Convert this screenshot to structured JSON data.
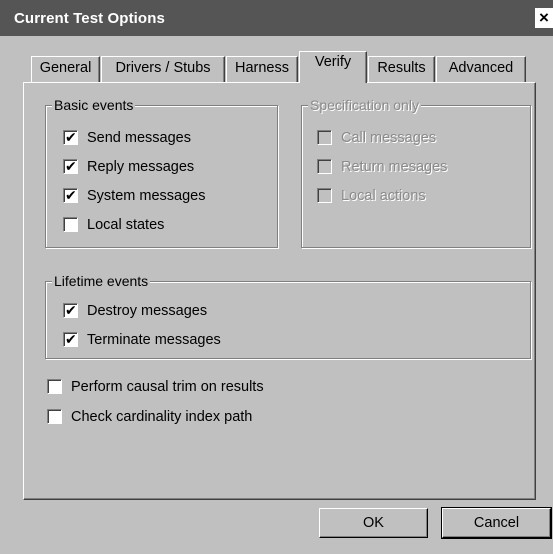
{
  "dialog": {
    "title": "Current Test Options",
    "close_glyph": "×"
  },
  "tabs": [
    {
      "label": "General",
      "active": false
    },
    {
      "label": "Drivers / Stubs",
      "active": false
    },
    {
      "label": "Harness",
      "active": false
    },
    {
      "label": "Verify",
      "active": true
    },
    {
      "label": "Results",
      "active": false
    },
    {
      "label": "Advanced",
      "active": false
    }
  ],
  "basic_events": {
    "label": "Basic events",
    "items": [
      {
        "label": "Send messages",
        "checked": true
      },
      {
        "label": "Reply messages",
        "checked": true
      },
      {
        "label": "System messages",
        "checked": true
      },
      {
        "label": "Local states",
        "checked": false
      }
    ]
  },
  "spec_only": {
    "label": "Specification only",
    "items": [
      {
        "label": "Call messages",
        "checked": false,
        "enabled": false
      },
      {
        "label": "Return mesages",
        "checked": false,
        "enabled": false
      },
      {
        "label": "Local actions",
        "checked": false,
        "enabled": false
      }
    ]
  },
  "lifetime_events": {
    "label": "Lifetime events",
    "items": [
      {
        "label": "Destroy messages",
        "checked": true
      },
      {
        "label": "Terminate messages",
        "checked": true
      }
    ]
  },
  "options": [
    {
      "label": "Perform causal trim on results",
      "checked": false
    },
    {
      "label": "Check cardinality index path",
      "checked": false
    }
  ],
  "buttons": {
    "ok": "OK",
    "cancel": "Cancel"
  }
}
